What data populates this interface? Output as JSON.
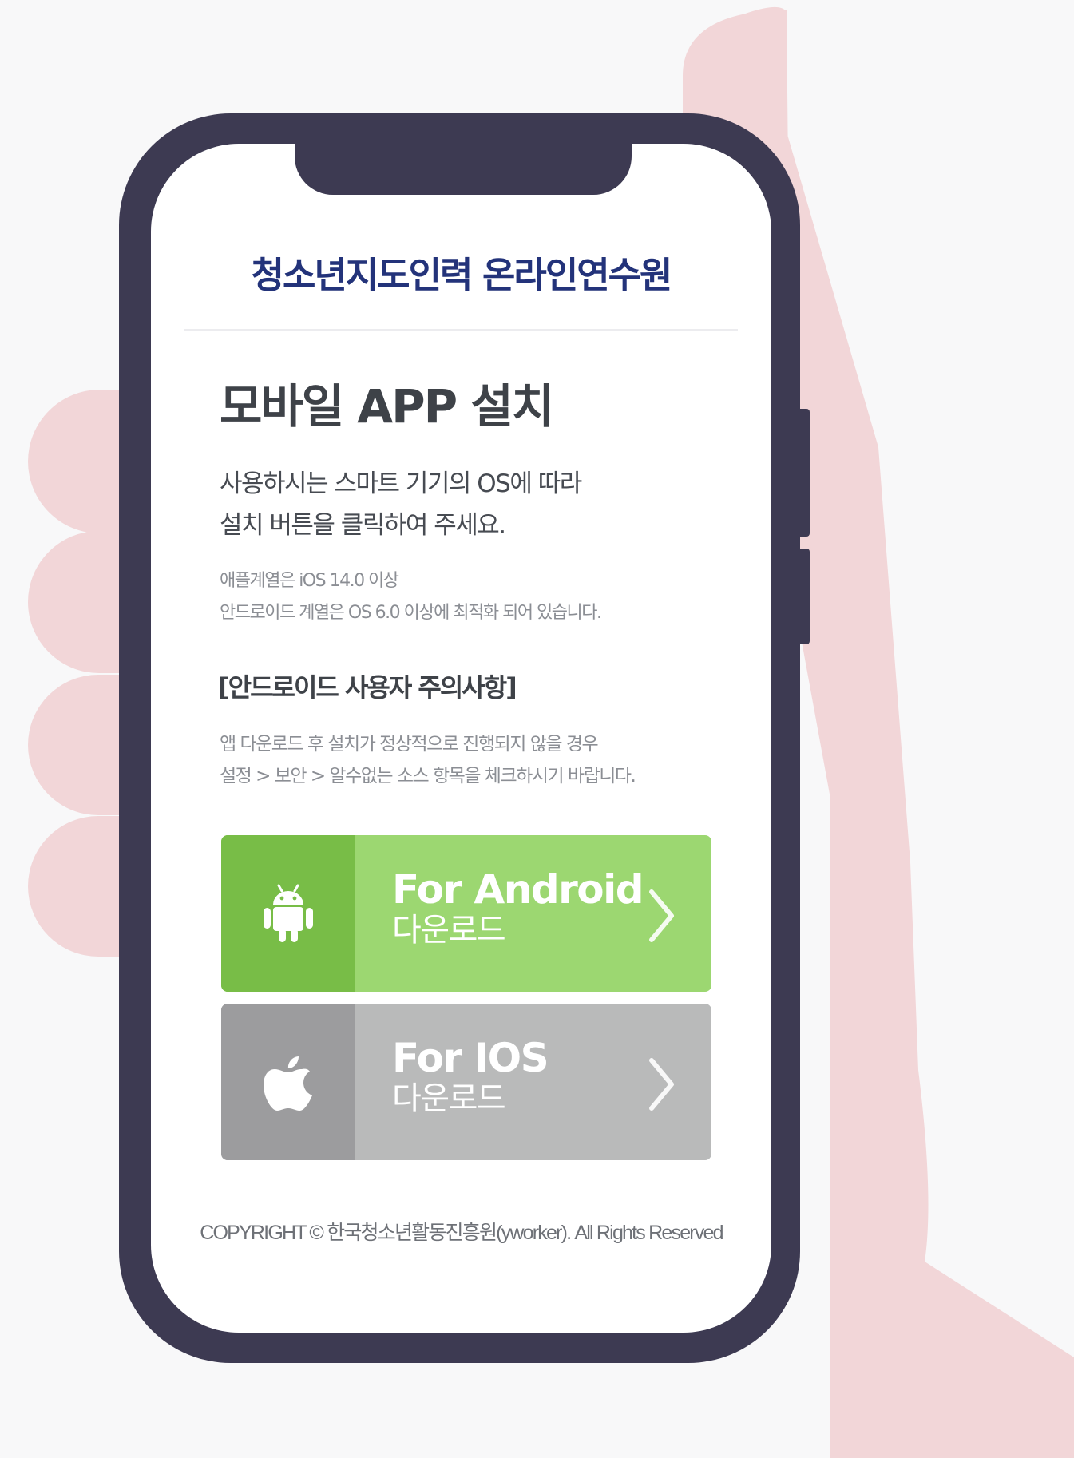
{
  "brand": {
    "title": "청소년지도인력 온라인연수원"
  },
  "page": {
    "title": "모바일 APP 설치",
    "lead": [
      "사용하시는 스마트 기기의 OS에 따라",
      "설치 버튼을 클릭하여 주세요."
    ],
    "note": [
      "애플계열은 iOS 14.0 이상",
      "안드로이드 계열은 OS 6.0 이상에 최적화 되어 있습니다."
    ]
  },
  "warning": {
    "title": "[안드로이드 사용자 주의사항]",
    "lines": [
      "앱 다운로드 후 설치가 정상적으로 진행되지 않을 경우",
      "설정 > 보안 > 알수없는 소스 항목을 체크하시기 바랍니다."
    ]
  },
  "buttons": {
    "android": {
      "label": "For Android",
      "sub": "다운로드",
      "icon": "android-icon",
      "color": "#9cd771",
      "icon_bg": "#78bd47"
    },
    "ios": {
      "label": "For IOS",
      "sub": "다운로드",
      "icon": "apple-icon",
      "color": "#b9baba",
      "icon_bg": "#9c9c9e"
    }
  },
  "footer": {
    "copyright": "COPYRIGHT © 한국청소년활동진흥원(yworker). All Rights Reserved"
  },
  "colors": {
    "frame": "#3d3a52",
    "hand": "#f2d6d8",
    "brand": "#23337a",
    "background": "#f8f8f9"
  }
}
